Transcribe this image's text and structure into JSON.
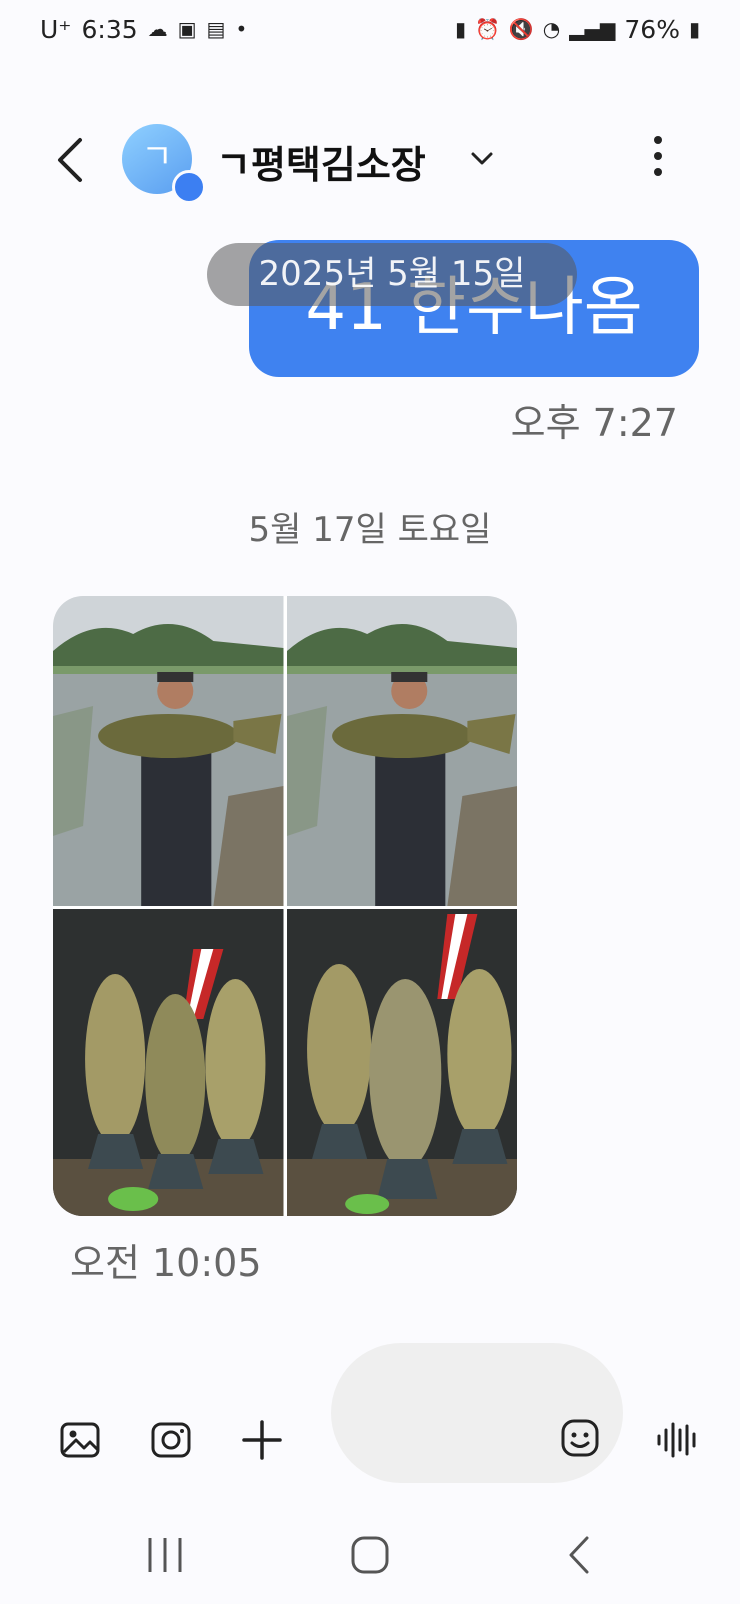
{
  "status_bar": {
    "carrier": "U⁺",
    "time": "6:35",
    "battery": "76%",
    "left_icons": [
      "cloud-icon",
      "gallery-icon",
      "pdf-icon",
      "dot-icon"
    ],
    "right_icons": [
      "battery-saver-icon",
      "alarm-icon",
      "mute-icon",
      "wifi-icon",
      "signal-icon",
      "battery-icon"
    ]
  },
  "header": {
    "avatar_letter": "ㄱ",
    "contact_name": "ㄱ평택김소장"
  },
  "messages": [
    {
      "direction": "sent",
      "text": "41 한수나옴",
      "time": "오후 7:27"
    },
    {
      "direction": "received",
      "type": "photos",
      "photo_count": 4,
      "time": "오전 10:05"
    }
  ],
  "date_pill": "2025년 5월 15일",
  "date_separator": "5월 17일 토요일",
  "composer": {
    "tools": [
      "gallery-icon",
      "camera-icon",
      "plus-icon"
    ],
    "trailing": [
      "emoji-icon",
      "voice-icon"
    ]
  },
  "colors": {
    "bubble_sent": "#3f82f0",
    "avatar": "#6aaef5",
    "background": "#fbfbfe"
  }
}
